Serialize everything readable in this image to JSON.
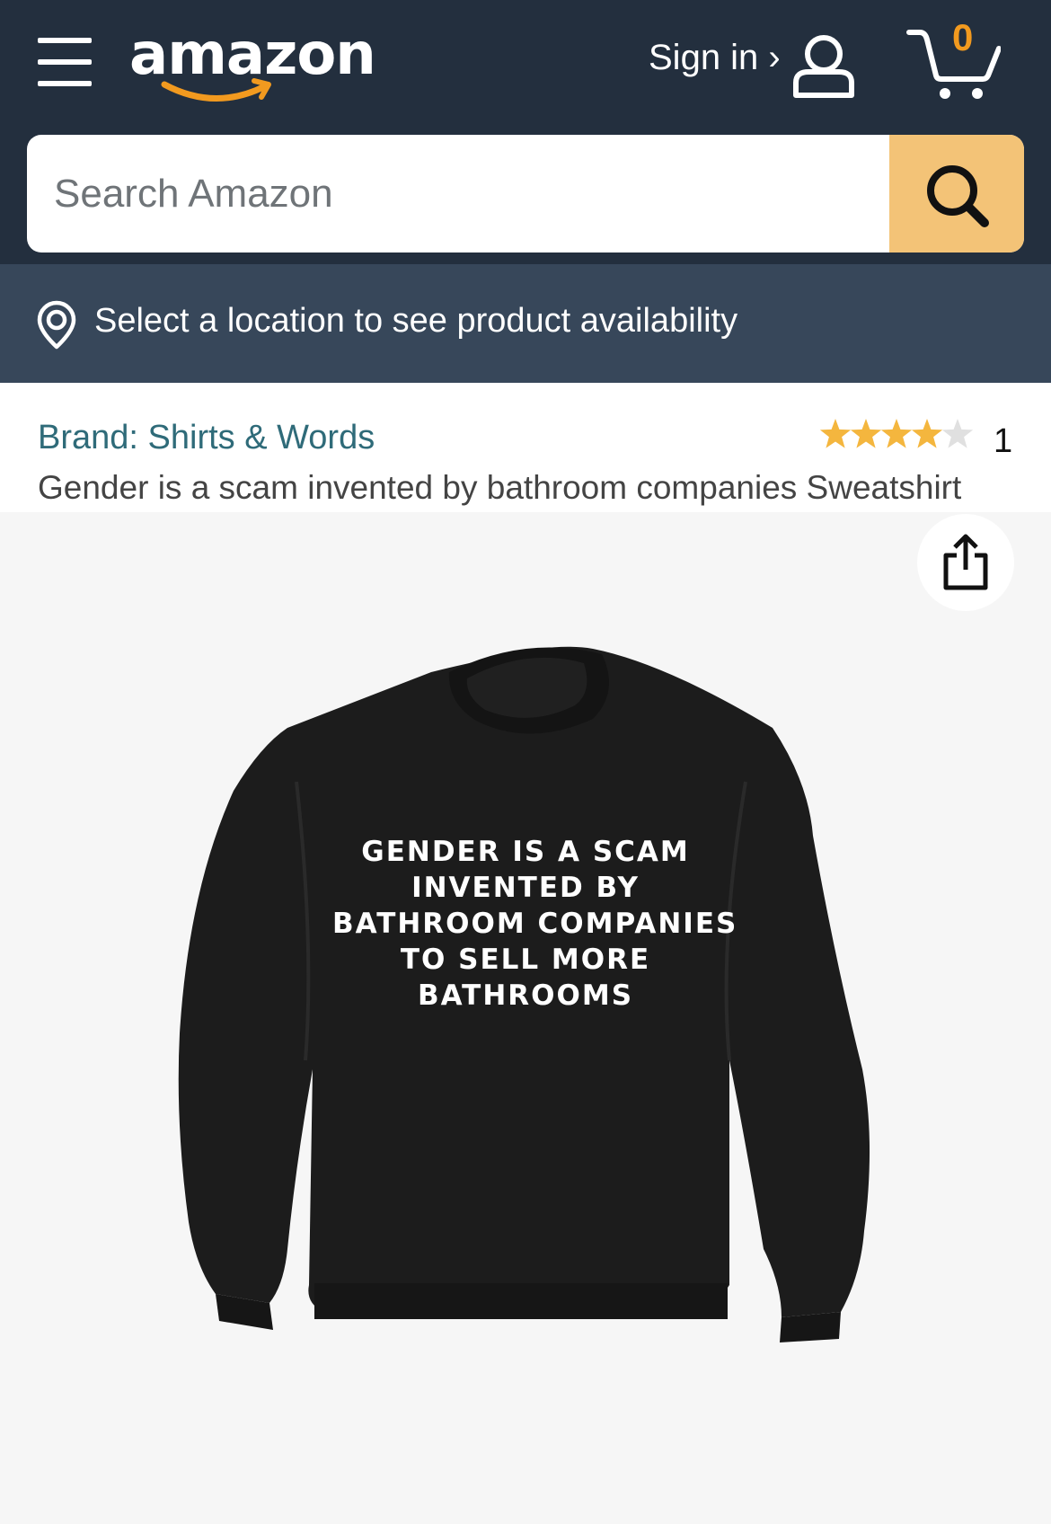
{
  "header": {
    "logo_text": "amazon",
    "signin_label": "Sign in ›",
    "cart_count": "0",
    "menu_icon": "hamburger-icon",
    "user_icon": "user-icon",
    "cart_icon": "cart-icon",
    "logo_smile_color": "#f29a1f"
  },
  "search": {
    "placeholder": "Search Amazon",
    "value": "",
    "button_icon": "search-icon",
    "button_color": "#f3c377"
  },
  "location_bar": {
    "icon": "location-pin-icon",
    "text": "Select a location to see product availability"
  },
  "product": {
    "brand": "Brand: Shirts & Words",
    "title": "Gender is a scam invented by bathroom companies Sweatshirt",
    "rating": 4,
    "rating_max": 5,
    "rating_count": "1",
    "share_icon": "share-icon",
    "print_lines": [
      "GENDER IS A SCAM",
      "INVENTED BY",
      "BATHROOM COMPANIES",
      "TO SELL MORE",
      "BATHROOMS"
    ]
  },
  "colors": {
    "header_bg": "#232f3e",
    "location_bg": "#37475a",
    "brand_link": "#2f6b79",
    "star": "#f4b63e",
    "star_empty": "#e0e0e0"
  }
}
